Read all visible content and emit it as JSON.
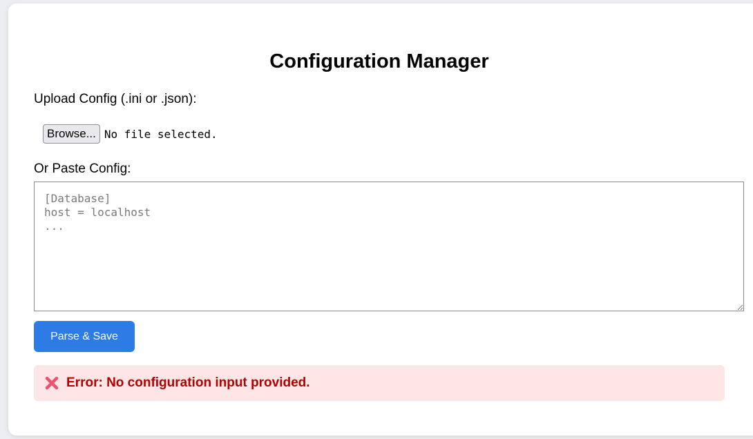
{
  "page": {
    "title": "Configuration Manager"
  },
  "upload": {
    "label": "Upload Config (.ini or .json):",
    "browse_label": "Browse...",
    "file_status": "No file selected."
  },
  "paste": {
    "label": "Or Paste Config:",
    "placeholder": "[Database]\nhost = localhost\n...",
    "value": ""
  },
  "actions": {
    "parse_save_label": "Parse & Save"
  },
  "error": {
    "icon": "cross-mark-icon",
    "message": "Error: No configuration input provided."
  },
  "colors": {
    "accent": "#2d7be5",
    "error_bg": "#ffe6e6",
    "error_text": "#b30000",
    "error_icon": "#f0506e"
  }
}
